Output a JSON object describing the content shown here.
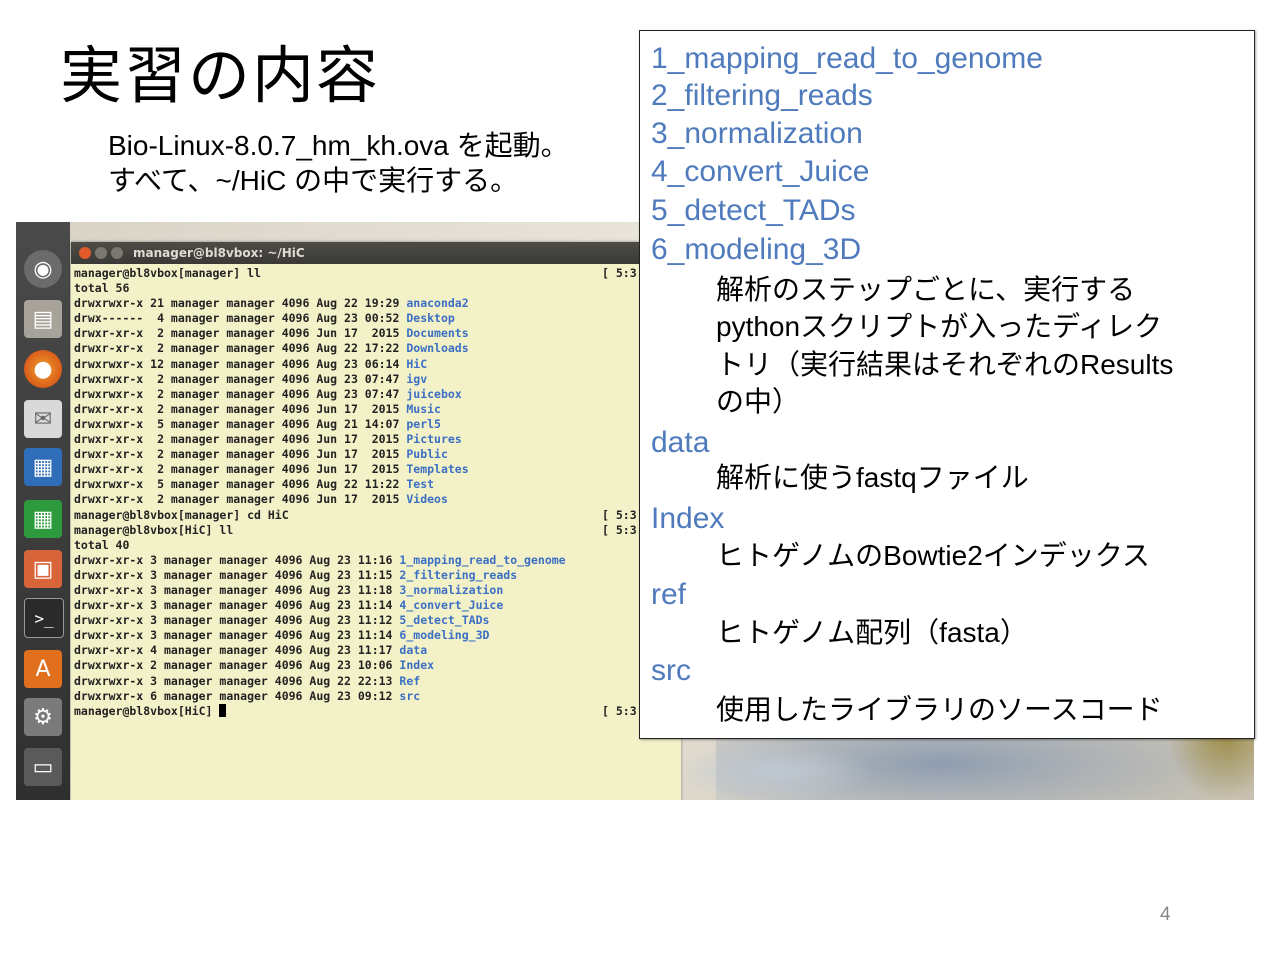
{
  "slide": {
    "title": "実習の内容",
    "intro_line1": "Bio-Linux-8.0.7_hm_kh.ova を起動。",
    "intro_line2": "すべて、~/HiC の中で実行する。",
    "page_number": "4"
  },
  "terminal": {
    "window_title": "manager@bl8vbox: ~/HiC",
    "lines": [
      {
        "text": "manager@bl8vbox[manager] ll",
        "tag": "[ 5:3"
      },
      {
        "text": "total 56"
      },
      {
        "text": "drwxrwxr-x 21 manager manager 4096 Aug 22 19:29 ",
        "dir": "anaconda2"
      },
      {
        "text": "drwx------  4 manager manager 4096 Aug 23 00:52 ",
        "dir": "Desktop"
      },
      {
        "text": "drwxr-xr-x  2 manager manager 4096 Jun 17  2015 ",
        "dir": "Documents"
      },
      {
        "text": "drwxr-xr-x  2 manager manager 4096 Aug 22 17:22 ",
        "dir": "Downloads"
      },
      {
        "text": "drwxrwxr-x 12 manager manager 4096 Aug 23 06:14 ",
        "dir": "HiC"
      },
      {
        "text": "drwxrwxr-x  2 manager manager 4096 Aug 23 07:47 ",
        "dir": "igv"
      },
      {
        "text": "drwxrwxr-x  2 manager manager 4096 Aug 23 07:47 ",
        "dir": "juicebox"
      },
      {
        "text": "drwxr-xr-x  2 manager manager 4096 Jun 17  2015 ",
        "dir": "Music"
      },
      {
        "text": "drwxrwxr-x  5 manager manager 4096 Aug 21 14:07 ",
        "dir": "perl5"
      },
      {
        "text": "drwxr-xr-x  2 manager manager 4096 Jun 17  2015 ",
        "dir": "Pictures"
      },
      {
        "text": "drwxr-xr-x  2 manager manager 4096 Jun 17  2015 ",
        "dir": "Public"
      },
      {
        "text": "drwxr-xr-x  2 manager manager 4096 Jun 17  2015 ",
        "dir": "Templates"
      },
      {
        "text": "drwxrwxr-x  5 manager manager 4096 Aug 22 11:22 ",
        "dir": "Test"
      },
      {
        "text": "drwxr-xr-x  2 manager manager 4096 Jun 17  2015 ",
        "dir": "Videos"
      },
      {
        "text": "manager@bl8vbox[manager] cd HiC",
        "tag": "[ 5:3"
      },
      {
        "text": "manager@bl8vbox[HiC] ll",
        "tag": "[ 5:3"
      },
      {
        "text": "total 40"
      },
      {
        "text": "drwxr-xr-x 3 manager manager 4096 Aug 23 11:16 ",
        "dir": "1_mapping_read_to_genome"
      },
      {
        "text": "drwxr-xr-x 3 manager manager 4096 Aug 23 11:15 ",
        "dir": "2_filtering_reads"
      },
      {
        "text": "drwxr-xr-x 3 manager manager 4096 Aug 23 11:18 ",
        "dir": "3_normalization"
      },
      {
        "text": "drwxr-xr-x 3 manager manager 4096 Aug 23 11:14 ",
        "dir": "4_convert_Juice"
      },
      {
        "text": "drwxr-xr-x 3 manager manager 4096 Aug 23 11:12 ",
        "dir": "5_detect_TADs"
      },
      {
        "text": "drwxr-xr-x 3 manager manager 4096 Aug 23 11:14 ",
        "dir": "6_modeling_3D"
      },
      {
        "text": "drwxr-xr-x 4 manager manager 4096 Aug 23 11:17 ",
        "dir": "data"
      },
      {
        "text": "drwxrwxr-x 2 manager manager 4096 Aug 23 10:06 ",
        "dir": "Index"
      },
      {
        "text": "drwxrwxr-x 3 manager manager 4096 Aug 22 22:13 ",
        "dir": "Ref"
      },
      {
        "text": "drwxrwxr-x 6 manager manager 4096 Aug 23 09:12 ",
        "dir": "src"
      },
      {
        "text": "manager@bl8vbox[HiC] ",
        "cursor": true,
        "tag": "[ 5:3"
      }
    ]
  },
  "launcher": {
    "icons": [
      "ubuntu-dash-icon",
      "files-icon",
      "firefox-icon",
      "mail-icon",
      "writer-icon",
      "calc-icon",
      "impress-icon",
      "terminal-icon",
      "software-center-icon",
      "settings-icon",
      "workspace-icon"
    ]
  },
  "infobox": {
    "dirs": [
      "1_mapping_read_to_genome",
      "2_filtering_reads",
      "3_normalization",
      "4_convert_Juice",
      "5_detect_TADs",
      "6_modeling_3D"
    ],
    "dirs_desc": [
      "解析のステップごとに、実行する",
      "pythonスクリプトが入ったディレク",
      "トリ（実行結果はそれぞれのResults",
      "の中）"
    ],
    "data_name": "data",
    "data_desc": "解析に使うfastqファイル",
    "index_name": "Index",
    "index_desc": "ヒトゲノムのBowtie2インデックス",
    "ref_name": "ref",
    "ref_desc": "ヒトゲノム配列（fasta）",
    "src_name": "src",
    "src_desc": "使用したライブラリのソースコード"
  },
  "colors": {
    "link_blue": "#4f7bbd",
    "terminal_bg": "#f3f1c8",
    "terminal_dir": "#3a6fc4"
  }
}
